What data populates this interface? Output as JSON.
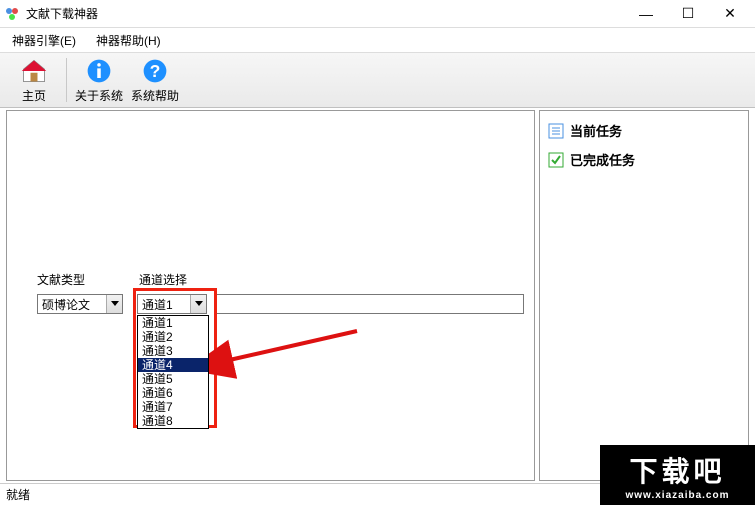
{
  "window": {
    "title": "文献下载神器",
    "minimize": "—",
    "maximize": "☐",
    "close": "✕"
  },
  "menu": {
    "engine": "神器引擎(E)",
    "help": "神器帮助(H)"
  },
  "toolbar": {
    "home": "主页",
    "about": "关于系统",
    "syshelp": "系统帮助"
  },
  "form": {
    "docTypeLabel": "文献类型",
    "channelLabel": "通道选择",
    "docTypeValue": "硕博论文",
    "channelValue": "通道1",
    "channelOptions": [
      "通道1",
      "通道2",
      "通道3",
      "通道4",
      "通道5",
      "通道6",
      "通道7",
      "通道8"
    ],
    "channelSelectedIndex": 3
  },
  "tasks": {
    "current": "当前任务",
    "completed": "已完成任务"
  },
  "status": {
    "ready": "就绪"
  },
  "watermark": {
    "text": "下载吧",
    "url": "www.xiazaiba.com"
  }
}
